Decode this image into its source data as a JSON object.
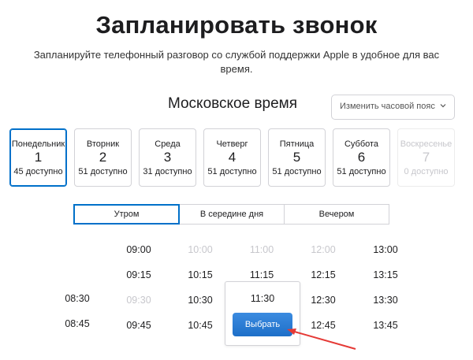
{
  "header": {
    "title": "Запланировать звонок",
    "subtitle": "Запланируйте телефонный разговор со службой поддержки Apple в удобное для вас время."
  },
  "timezone": {
    "label": "Московское время",
    "select_placeholder": "Изменить часовой пояс"
  },
  "days": [
    {
      "name": "Понедельник",
      "date": "1",
      "availability": "45 доступно",
      "state": "selected"
    },
    {
      "name": "Вторник",
      "date": "2",
      "availability": "51 доступно",
      "state": "normal"
    },
    {
      "name": "Среда",
      "date": "3",
      "availability": "31 доступно",
      "state": "normal"
    },
    {
      "name": "Четверг",
      "date": "4",
      "availability": "51 доступно",
      "state": "normal"
    },
    {
      "name": "Пятница",
      "date": "5",
      "availability": "51 доступно",
      "state": "normal"
    },
    {
      "name": "Суббота",
      "date": "6",
      "availability": "51 доступно",
      "state": "normal"
    },
    {
      "name": "Воскресенье",
      "date": "7",
      "availability": "0 доступно",
      "state": "disabled"
    }
  ],
  "period_tabs": [
    {
      "label": "Утром",
      "active": true
    },
    {
      "label": "В середине дня",
      "active": false
    },
    {
      "label": "Вечером",
      "active": false
    }
  ],
  "time_slots": [
    {
      "columns": [
        {
          "time": "08:30",
          "available": true
        },
        {
          "time": "08:45",
          "available": true
        }
      ]
    },
    {
      "columns": [
        {
          "time": "09:00",
          "available": true
        },
        {
          "time": "09:15",
          "available": true
        },
        {
          "time": "09:30",
          "available": false
        },
        {
          "time": "09:45",
          "available": true
        }
      ]
    },
    {
      "columns": [
        {
          "time": "10:00",
          "available": false
        },
        {
          "time": "10:15",
          "available": true
        },
        {
          "time": "10:30",
          "available": true
        },
        {
          "time": "10:45",
          "available": true
        }
      ]
    },
    {
      "columns": [
        {
          "time": "11:00",
          "available": false
        },
        {
          "time": "11:15",
          "available": true
        }
      ]
    },
    {
      "columns": [
        {
          "time": "12:00",
          "available": false
        },
        {
          "time": "12:15",
          "available": true
        },
        {
          "time": "12:30",
          "available": true
        },
        {
          "time": "12:45",
          "available": true
        }
      ]
    },
    {
      "columns": [
        {
          "time": "13:00",
          "available": true
        },
        {
          "time": "13:15",
          "available": true
        },
        {
          "time": "13:30",
          "available": true
        },
        {
          "time": "13:45",
          "available": true
        }
      ]
    }
  ],
  "popover": {
    "selected_time": "11:30",
    "select_label": "Выбрать"
  },
  "colors": {
    "accent": "#0070c9",
    "button": "#2a7bd6",
    "annotation_arrow": "#e53935",
    "disabled_text": "#c7c7cc"
  }
}
